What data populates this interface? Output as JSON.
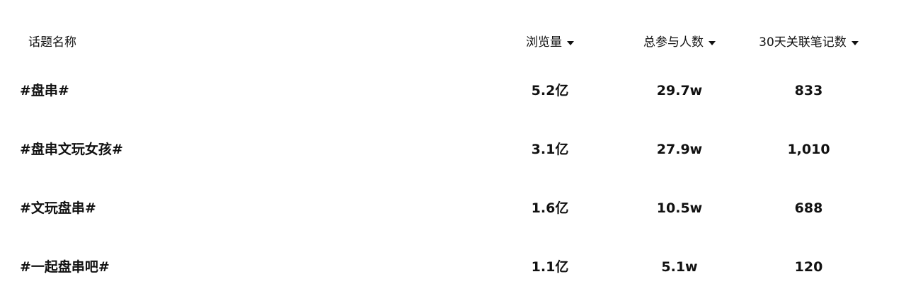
{
  "header": {
    "topic_name": "话题名称",
    "views": "浏览量",
    "participants": "总参与人数",
    "notes_30d": "30天关联笔记数"
  },
  "icons": {
    "sort": "caret-down-icon"
  },
  "rows": [
    {
      "topic": "#盘串#",
      "views": "5.2亿",
      "participants": "29.7w",
      "notes": "833"
    },
    {
      "topic": "#盘串文玩女孩#",
      "views": "3.1亿",
      "participants": "27.9w",
      "notes": "1,010"
    },
    {
      "topic": "#文玩盘串#",
      "views": "1.6亿",
      "participants": "10.5w",
      "notes": "688"
    },
    {
      "topic": "#一起盘串吧#",
      "views": "1.1亿",
      "participants": "5.1w",
      "notes": "120"
    }
  ]
}
